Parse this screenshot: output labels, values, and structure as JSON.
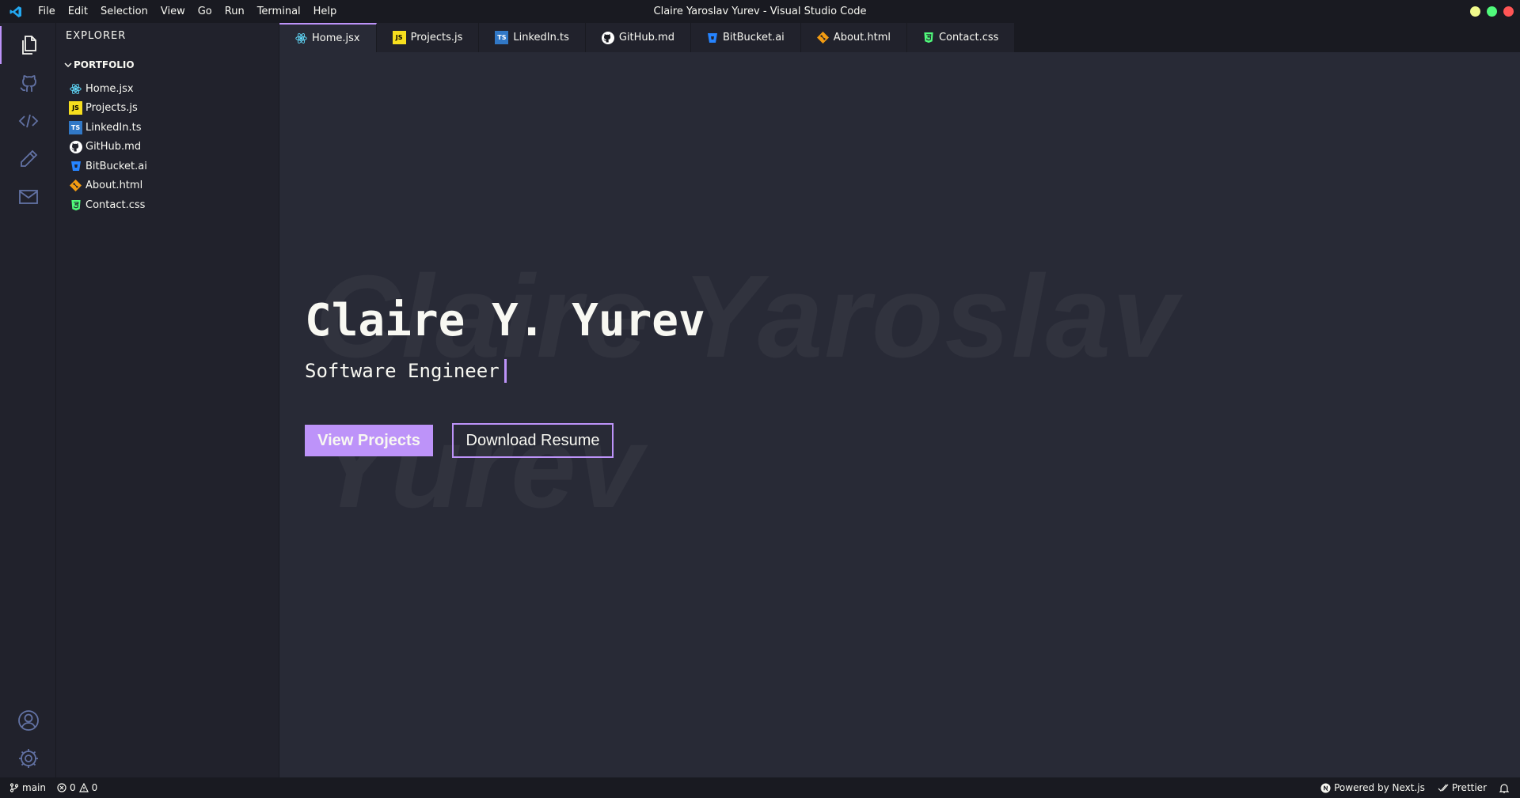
{
  "window": {
    "title": "Claire Yaroslav Yurev - Visual Studio Code",
    "traffic_colors": [
      "#f1fa8c",
      "#50fa7b",
      "#ff5555"
    ]
  },
  "menu": [
    "File",
    "Edit",
    "Selection",
    "View",
    "Go",
    "Run",
    "Terminal",
    "Help"
  ],
  "activity_bar": {
    "top": [
      "files-icon",
      "github-icon",
      "code-icon",
      "pencil-icon",
      "mail-icon"
    ],
    "bottom": [
      "account-icon",
      "settings-gear-icon"
    ]
  },
  "sidebar": {
    "title": "EXPLORER",
    "folder": "PORTFOLIO",
    "files": [
      {
        "name": "Home.jsx",
        "icon": "react-icon",
        "color": "#61dafb"
      },
      {
        "name": "Projects.js",
        "icon": "javascript-icon",
        "color": "#f7df1e"
      },
      {
        "name": "LinkedIn.ts",
        "icon": "typescript-icon",
        "color": "#3178c6"
      },
      {
        "name": "GitHub.md",
        "icon": "github-icon",
        "color": "#ffffff"
      },
      {
        "name": "BitBucket.ai",
        "icon": "bitbucket-icon",
        "color": "#2684ff"
      },
      {
        "name": "About.html",
        "icon": "git-icon",
        "color": "#f39c12"
      },
      {
        "name": "Contact.css",
        "icon": "css-icon",
        "color": "#50fa7b"
      }
    ]
  },
  "tabs": [
    {
      "label": "Home.jsx",
      "active": true
    },
    {
      "label": "Projects.js",
      "active": false
    },
    {
      "label": "LinkedIn.ts",
      "active": false
    },
    {
      "label": "GitHub.md",
      "active": false
    },
    {
      "label": "BitBucket.ai",
      "active": false
    },
    {
      "label": "About.html",
      "active": false
    },
    {
      "label": "Contact.css",
      "active": false
    }
  ],
  "hero": {
    "background_name": "Claire Yaroslav Yurev",
    "name": "Claire Y. Yurev",
    "role": "Software Engineer",
    "primary_button": "View Projects",
    "secondary_button": "Download Resume"
  },
  "status_bar": {
    "branch": "main",
    "errors": "0",
    "warnings": "0",
    "powered_by": "Powered by Next.js",
    "prettier": "Prettier"
  },
  "colors": {
    "accent": "#bd93f9",
    "editor_bg": "#282a36",
    "sidebar_bg": "#21222c",
    "titlebar_bg": "#191a21"
  }
}
